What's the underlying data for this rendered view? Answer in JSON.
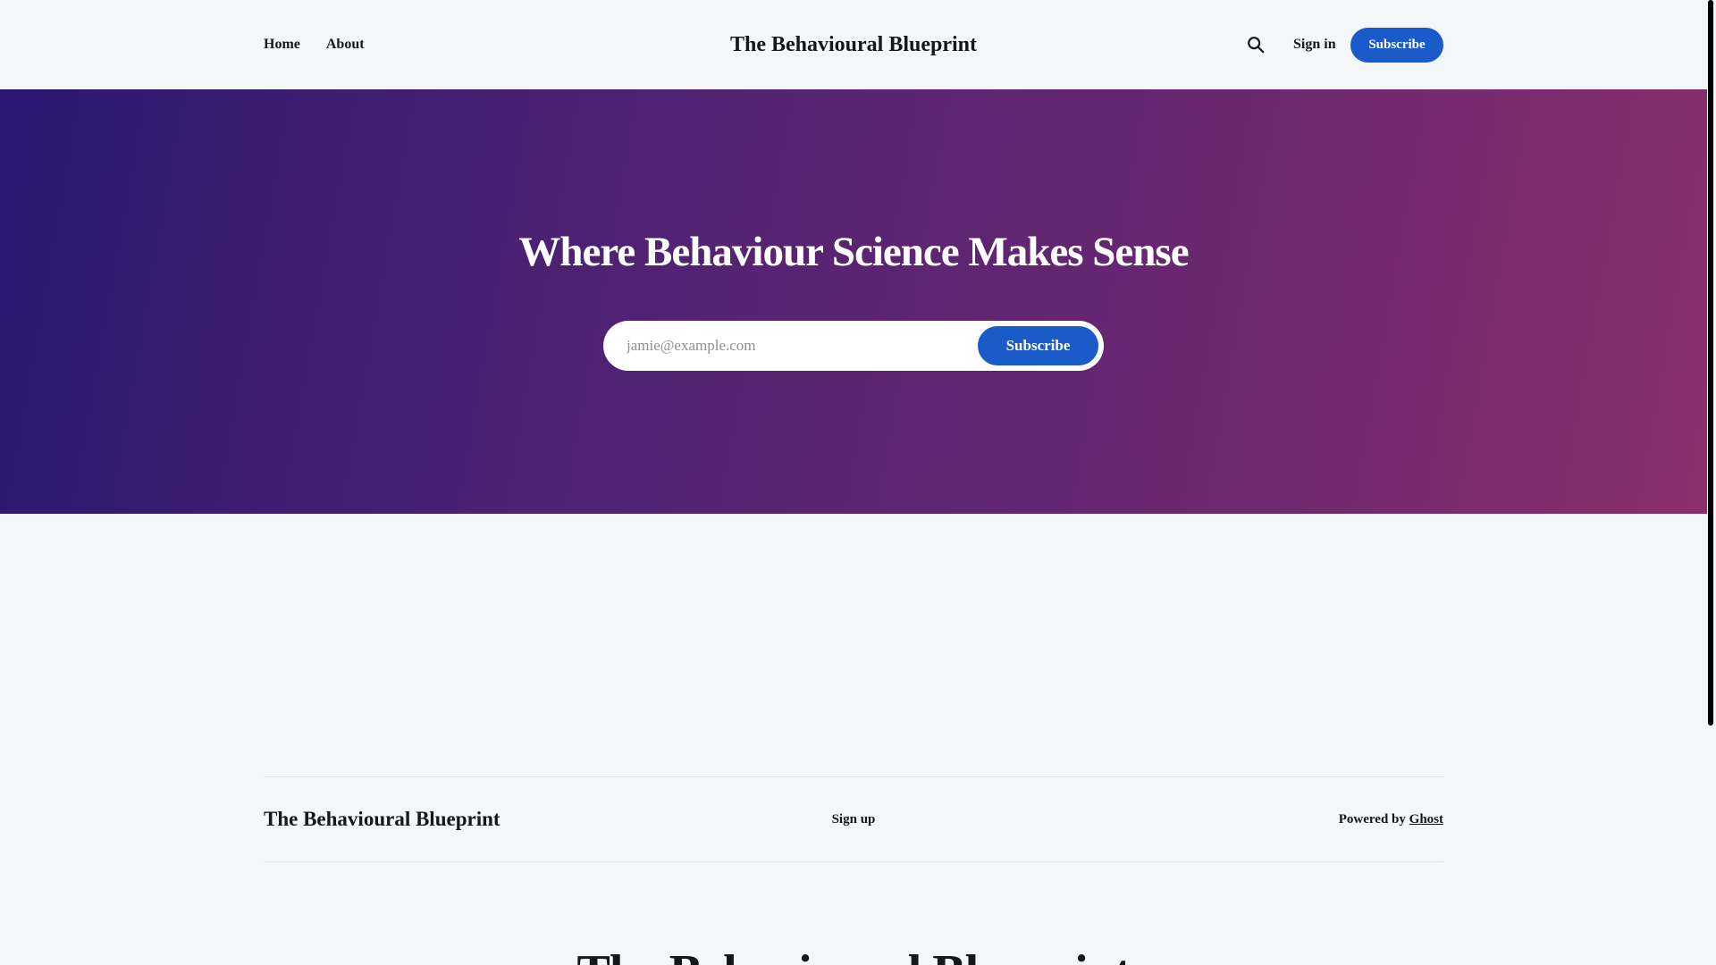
{
  "header": {
    "nav": [
      {
        "label": "Home"
      },
      {
        "label": "About"
      }
    ],
    "site_title": "The Behavioural Blueprint",
    "search_icon": "search-icon",
    "signin_label": "Sign in",
    "subscribe_label": "Subscribe"
  },
  "hero": {
    "title": "Where Behaviour Science Makes Sense",
    "email_placeholder": "jamie@example.com",
    "subscribe_label": "Subscribe",
    "gradient_colors": [
      "#2a1872",
      "#4e2273",
      "#6e2870",
      "#8b2f6c"
    ]
  },
  "footer": {
    "site_title": "The Behavioural Blueprint",
    "signup_label": "Sign up",
    "powered_by_text": "Powered by",
    "powered_by_link": "Ghost"
  },
  "bottom_section": {
    "title": "The Behavioural Blueprint"
  },
  "colors": {
    "accent": "#1a5ac9",
    "background": "#f4f7fa",
    "text": "#15171a"
  }
}
